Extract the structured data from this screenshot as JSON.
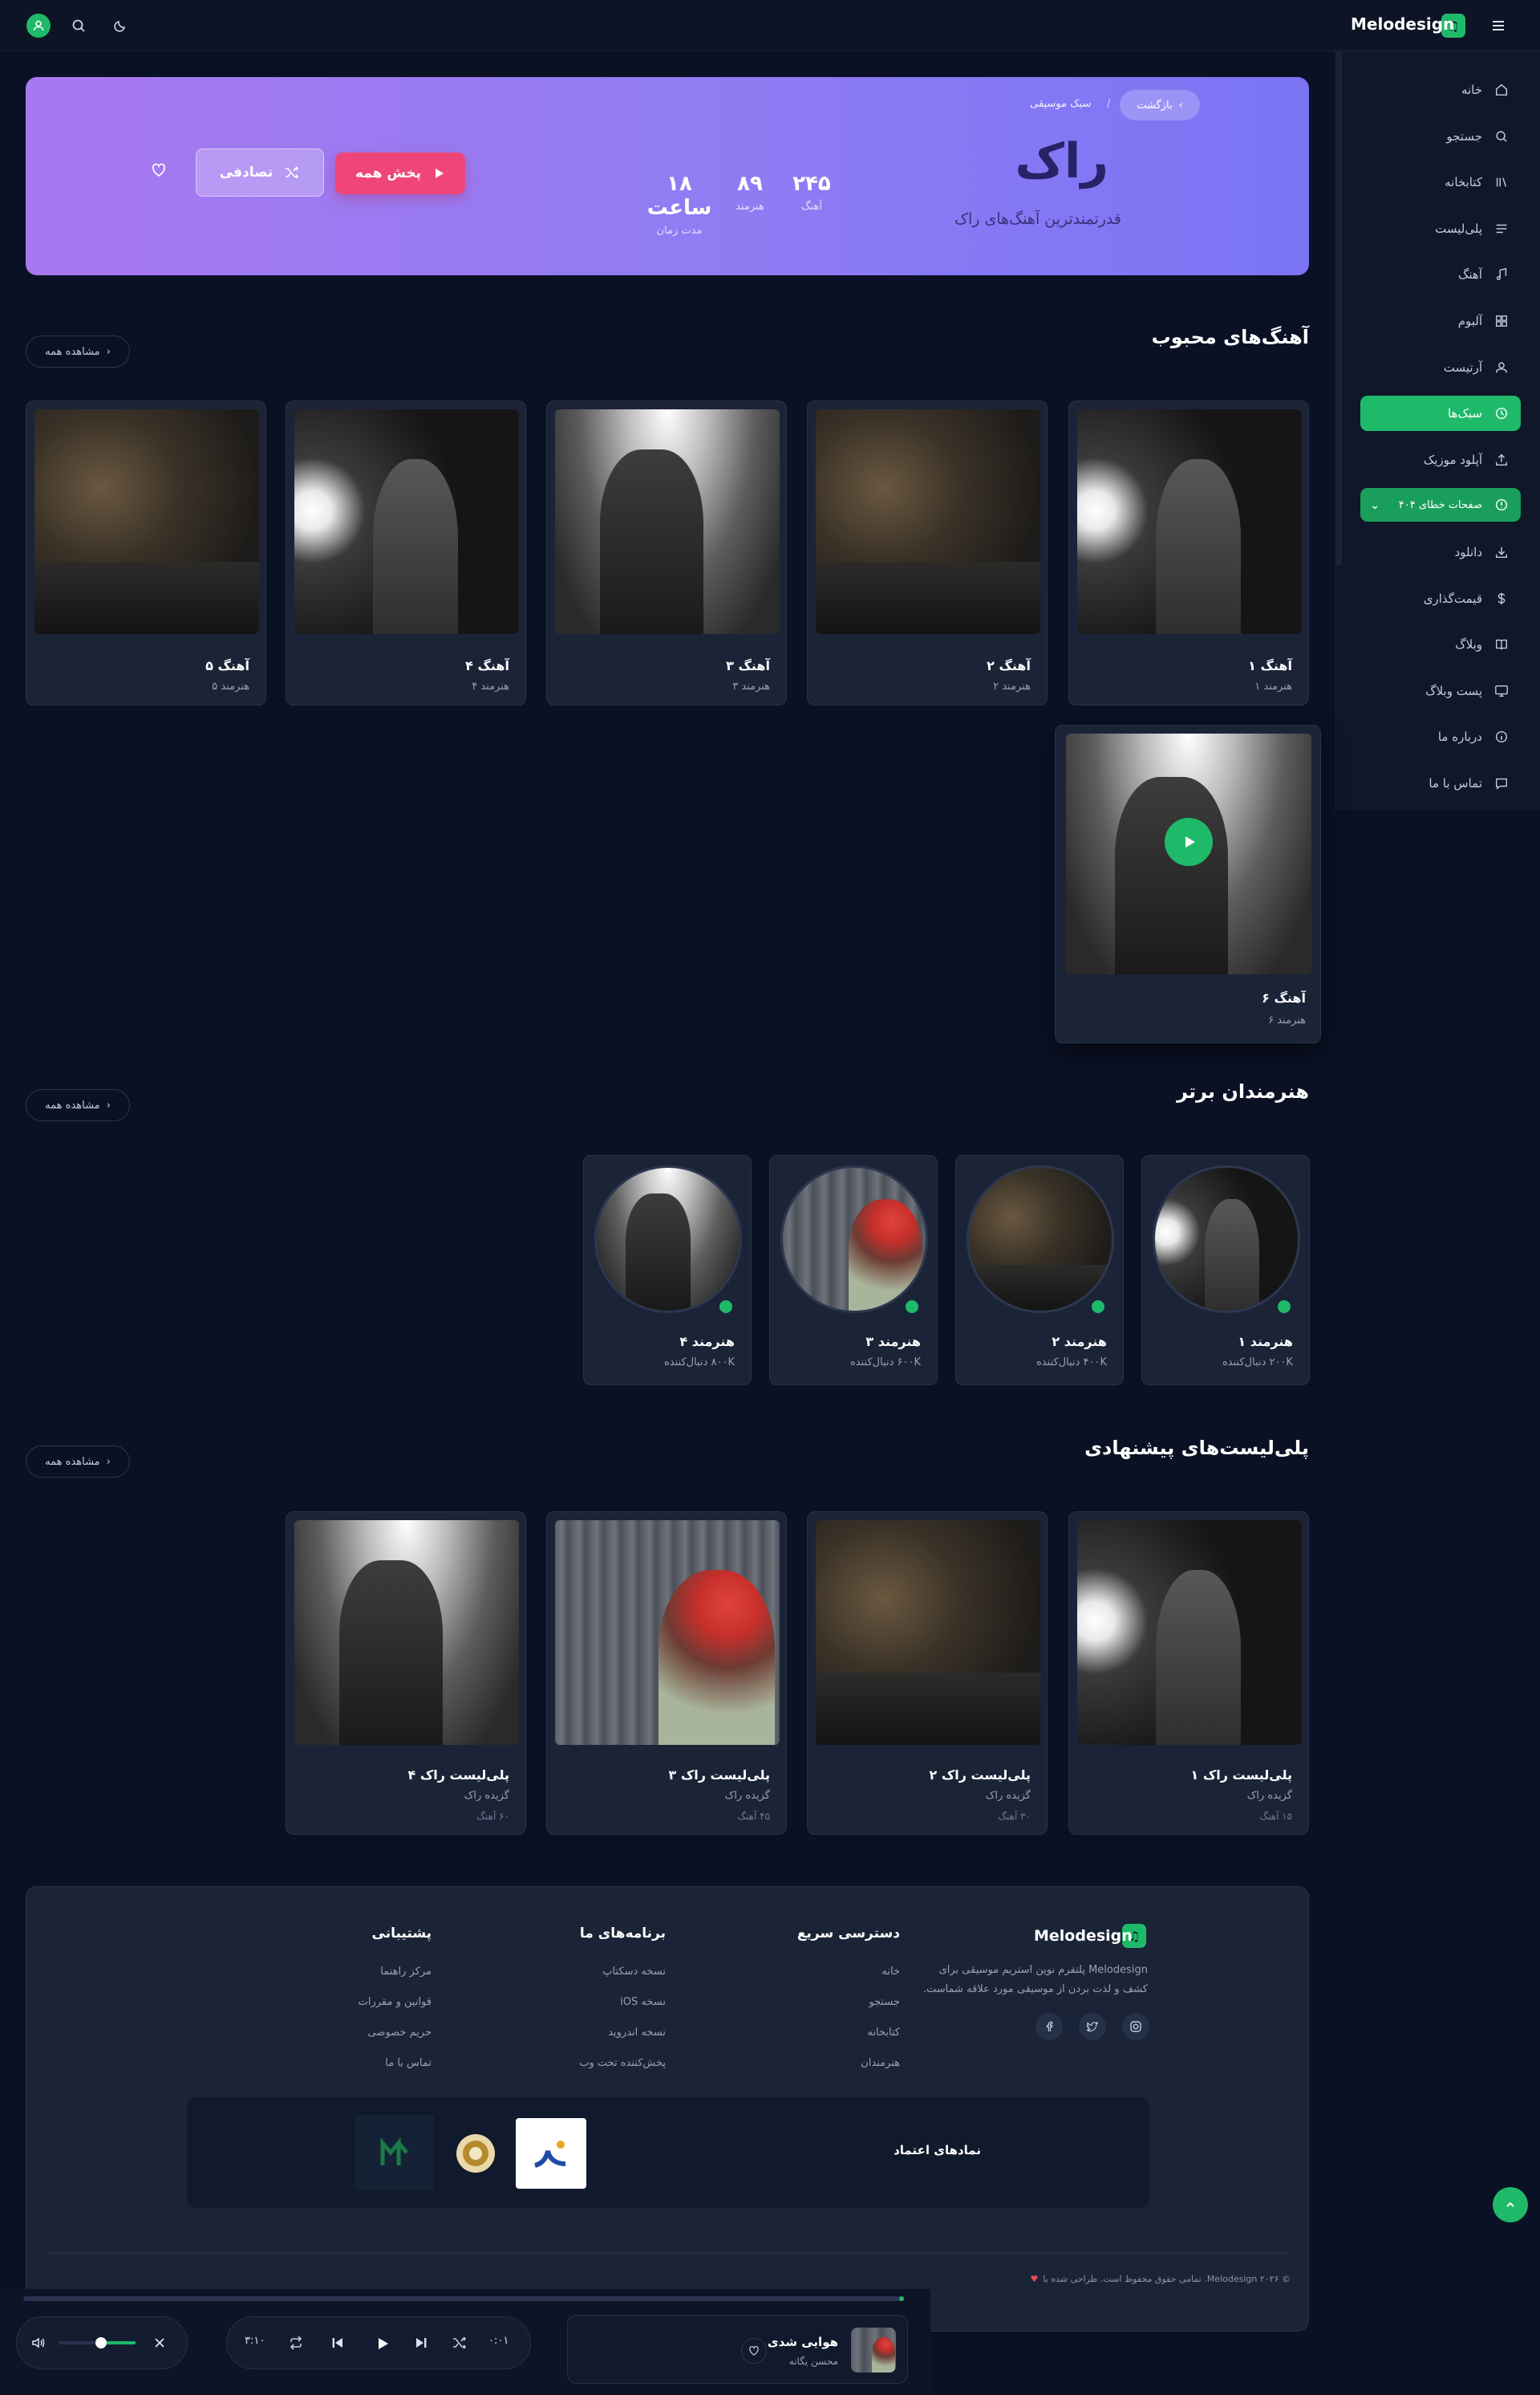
{
  "header": {
    "logo_text": "Melodesign"
  },
  "sidebar": {
    "items": [
      {
        "label": "خانه",
        "icon": "home-icon"
      },
      {
        "label": "جستجو",
        "icon": "search-icon"
      },
      {
        "label": "کتابخانه",
        "icon": "library-icon"
      },
      {
        "label": "پلی‌لیست",
        "icon": "playlist-icon"
      },
      {
        "label": "آهنگ",
        "icon": "music-note-icon"
      },
      {
        "label": "آلبوم",
        "icon": "album-icon"
      },
      {
        "label": "آرتیست",
        "icon": "user-icon"
      },
      {
        "label": "سبک‌ها",
        "icon": "genre-icon",
        "active": true
      },
      {
        "label": "آپلود موزیک",
        "icon": "upload-icon"
      },
      {
        "label": "صفحات خطای ۴۰۴",
        "icon": "alert-icon",
        "active": true
      },
      {
        "label": "دانلود",
        "icon": "download-icon"
      },
      {
        "label": "قیمت‌گذاری",
        "icon": "dollar-icon"
      },
      {
        "label": "وبلاگ",
        "icon": "book-icon"
      },
      {
        "label": "پست وبلاگ",
        "icon": "monitor-icon"
      },
      {
        "label": "درباره ما",
        "icon": "info-icon"
      },
      {
        "label": "تماس با ما",
        "icon": "chat-icon"
      }
    ]
  },
  "hero": {
    "back_label": "بازگشت",
    "breadcrumb_sep": "/",
    "breadcrumb_current": "سبک موسیقی",
    "title": "راک",
    "subtitle": "قدرتمندترین آهنگ‌های راک",
    "stats": [
      {
        "value": "۲۴۵",
        "label": "آهنگ"
      },
      {
        "value": "۸۹",
        "label": "هنرمند"
      },
      {
        "value": "۱۸ ساعت",
        "label": "مدت زمان"
      }
    ],
    "play_all_label": "پخش همه",
    "shuffle_label": "تصادفی"
  },
  "popular": {
    "title": "آهنگ‌های محبوب",
    "see_all": "مشاهده همه",
    "songs": [
      {
        "title": "آهنگ ۱",
        "artist": "هنرمند ۱"
      },
      {
        "title": "آهنگ ۲",
        "artist": "هنرمند ۲"
      },
      {
        "title": "آهنگ ۳",
        "artist": "هنرمند ۳"
      },
      {
        "title": "آهنگ ۴",
        "artist": "هنرمند ۴"
      },
      {
        "title": "آهنگ ۵",
        "artist": "هنرمند ۵"
      },
      {
        "title": "آهنگ ۶",
        "artist": "هنرمند ۶"
      }
    ]
  },
  "artists": {
    "title": "هنرمندان برتر",
    "see_all": "مشاهده همه",
    "items": [
      {
        "name": "هنرمند ۱",
        "followers": "۲۰۰K دنبال‌کننده"
      },
      {
        "name": "هنرمند ۲",
        "followers": "۴۰۰K دنبال‌کننده"
      },
      {
        "name": "هنرمند ۳",
        "followers": "۶۰۰K دنبال‌کننده"
      },
      {
        "name": "هنرمند ۴",
        "followers": "۸۰۰K دنبال‌کننده"
      }
    ]
  },
  "playlists": {
    "title": "پلی‌لیست‌های پیشنهادی",
    "see_all": "مشاهده همه",
    "items": [
      {
        "title": "پلی‌لیست راک ۱",
        "sub": "گزیده راک",
        "count": "۱۵ آهنگ"
      },
      {
        "title": "پلی‌لیست راک ۲",
        "sub": "گزیده راک",
        "count": "۳۰ آهنگ"
      },
      {
        "title": "پلی‌لیست راک ۳",
        "sub": "گزیده راک",
        "count": "۴۵ آهنگ"
      },
      {
        "title": "پلی‌لیست راک ۴",
        "sub": "گزیده راک",
        "count": "۶۰ آهنگ"
      }
    ]
  },
  "footer": {
    "brand": "Melodesign",
    "description_1": "Melodesign پلتفرم نوین استریم موسیقی برای",
    "description_2": "کشف و لذت بردن از موسیقی مورد علاقه شماست.",
    "columns": [
      {
        "title": "دسترسی سریع",
        "links": [
          "خانه",
          "جستجو",
          "کتابخانه",
          "هنرمندان"
        ]
      },
      {
        "title": "برنامه‌های ما",
        "links": [
          "نسخه دسکتاپ",
          "نسخه iOS",
          "نسخه اندروید",
          "پخش‌کننده تحت وب"
        ]
      },
      {
        "title": "پشتیبانی",
        "links": [
          "مرکز راهنما",
          "قوانین و مقررات",
          "حریم خصوصی",
          "تماس با ما"
        ]
      }
    ],
    "trust_title": "نمادهای اعتماد",
    "copyright": "© ۲۰۲۶ Melodesign. تمامی حقوق محفوظ است. طراحی شده با"
  },
  "player": {
    "track_title": "هوایی شدی",
    "track_artist": "محسن یگانه",
    "current_time": "۰:۰۱",
    "duration": "۳:۱۰",
    "progress_fraction": 0.005,
    "volume_fraction": 0.45
  },
  "colors": {
    "accent": "#1fb96a",
    "play_button": "#f0457a",
    "hero_gradient_start": "#a878f0",
    "hero_gradient_end": "#7a74f4",
    "background": "#0b1124"
  }
}
